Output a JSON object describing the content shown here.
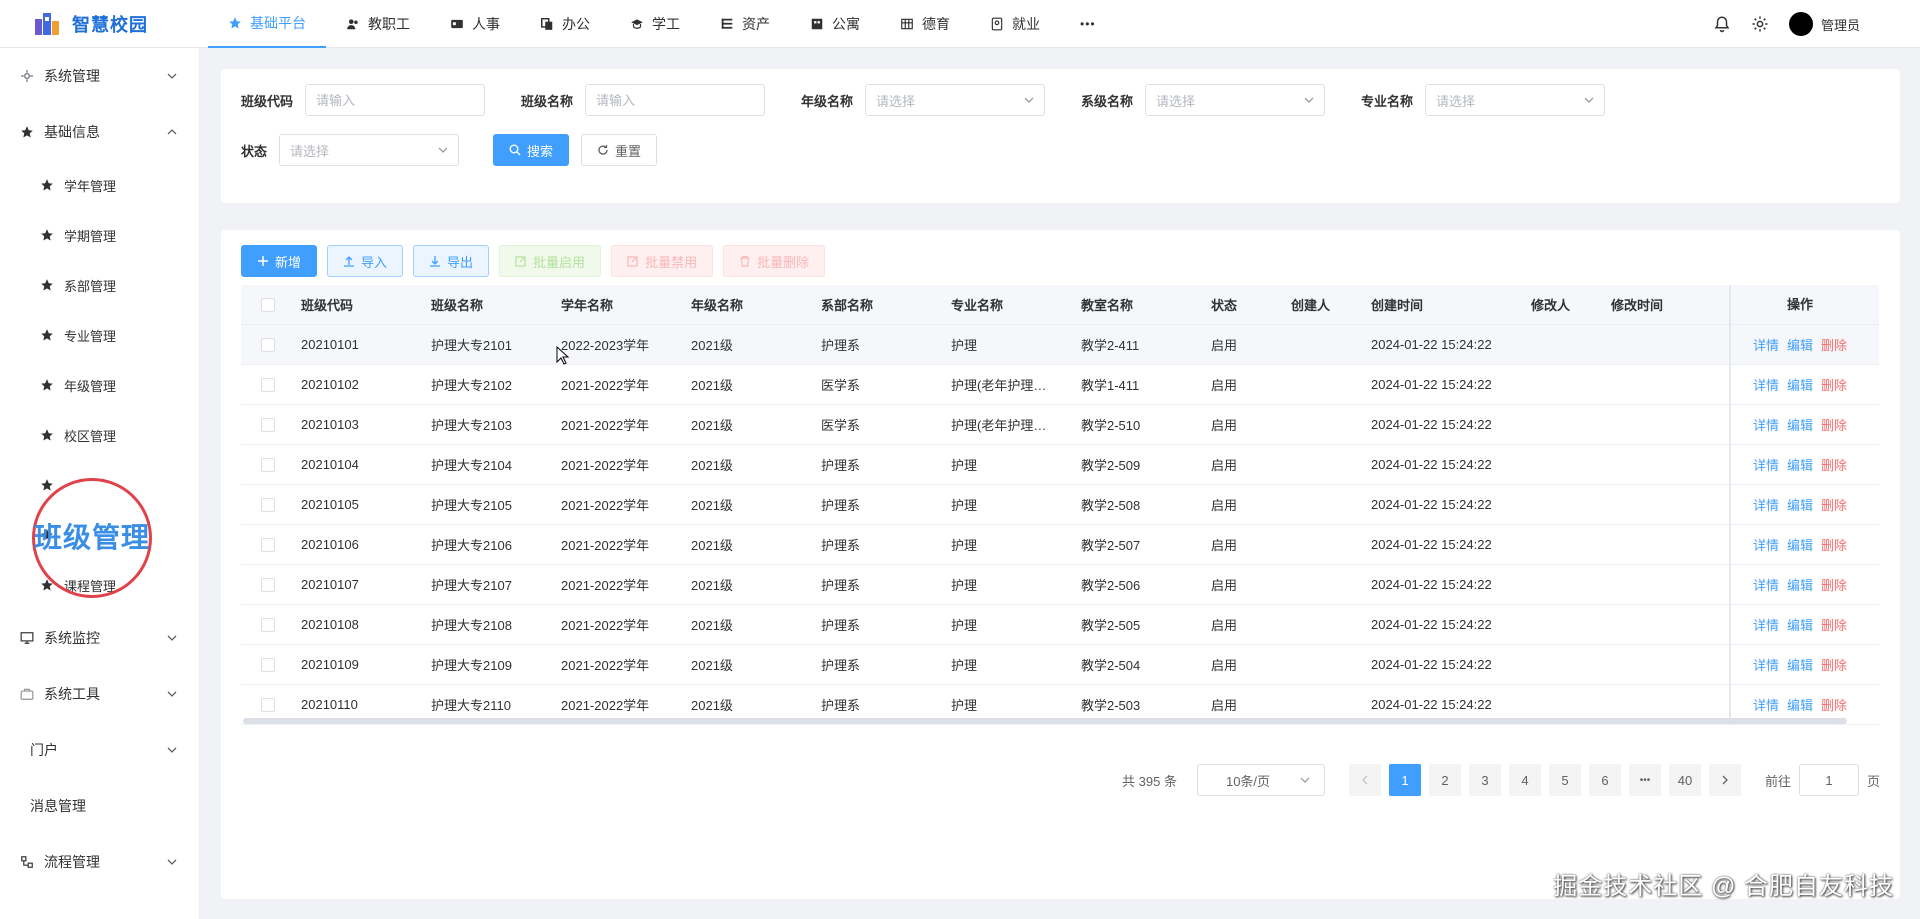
{
  "app": {
    "title": "智慧校园",
    "brand_color": "#1e6fd9",
    "accent_color": "#409eff"
  },
  "topnav": [
    {
      "label": "基础平台",
      "icon": "star-icon",
      "active": true
    },
    {
      "label": "教职工",
      "icon": "users-icon"
    },
    {
      "label": "人事",
      "icon": "id-card-icon"
    },
    {
      "label": "办公",
      "icon": "copy-icon"
    },
    {
      "label": "学工",
      "icon": "student-icon"
    },
    {
      "label": "资产",
      "icon": "list-icon"
    },
    {
      "label": "公寓",
      "icon": "building-icon"
    },
    {
      "label": "德育",
      "icon": "table-icon"
    },
    {
      "label": "就业",
      "icon": "badge-icon"
    },
    {
      "label": "•••",
      "icon": "more-icon"
    }
  ],
  "user": {
    "name": "管理员"
  },
  "sidebar": {
    "groups": {
      "system_manage": "系统管理",
      "basic_info": "基础信息",
      "system_monitor": "系统监控",
      "system_tools": "系统工具",
      "portal": "门户",
      "message": "消息管理",
      "workflow": "流程管理"
    },
    "basic_items": [
      "学年管理",
      "学期管理",
      "系部管理",
      "专业管理",
      "年级管理",
      "校区管理",
      "",
      "",
      "课程管理"
    ],
    "highlight_label": "班级管理"
  },
  "search": {
    "fields": {
      "class_code": {
        "label": "班级代码",
        "placeholder": "请输入"
      },
      "class_name": {
        "label": "班级名称",
        "placeholder": "请输入"
      },
      "grade_name": {
        "label": "年级名称",
        "placeholder": "请选择"
      },
      "dept_name": {
        "label": "系级名称",
        "placeholder": "请选择"
      },
      "major_name": {
        "label": "专业名称",
        "placeholder": "请选择"
      },
      "status": {
        "label": "状态",
        "placeholder": "请选择"
      }
    },
    "search_label": "搜索",
    "reset_label": "重置"
  },
  "toolbar": {
    "new_label": "新增",
    "import_label": "导入",
    "export_label": "导出",
    "batch_enable_label": "批量启用",
    "batch_disable_label": "批量禁用",
    "batch_delete_label": "批量删除"
  },
  "table": {
    "columns": [
      "班级代码",
      "班级名称",
      "学年名称",
      "年级名称",
      "系部名称",
      "专业名称",
      "教室名称",
      "状态",
      "创建人",
      "创建时间",
      "修改人",
      "修改时间",
      "操作"
    ],
    "actions": {
      "detail": "详情",
      "edit": "编辑",
      "delete": "删除"
    },
    "rows": [
      [
        "20210101",
        "护理大专2101",
        "2022-2023学年",
        "2021级",
        "护理系",
        "护理",
        "教学2-411",
        "启用",
        "",
        "2024-01-22 15:24:22",
        "",
        ""
      ],
      [
        "20210102",
        "护理大专2102",
        "2021-2022学年",
        "2021级",
        "医学系",
        "护理(老年护理…",
        "教学1-411",
        "启用",
        "",
        "2024-01-22 15:24:22",
        "",
        ""
      ],
      [
        "20210103",
        "护理大专2103",
        "2021-2022学年",
        "2021级",
        "医学系",
        "护理(老年护理…",
        "教学2-510",
        "启用",
        "",
        "2024-01-22 15:24:22",
        "",
        ""
      ],
      [
        "20210104",
        "护理大专2104",
        "2021-2022学年",
        "2021级",
        "护理系",
        "护理",
        "教学2-509",
        "启用",
        "",
        "2024-01-22 15:24:22",
        "",
        ""
      ],
      [
        "20210105",
        "护理大专2105",
        "2021-2022学年",
        "2021级",
        "护理系",
        "护理",
        "教学2-508",
        "启用",
        "",
        "2024-01-22 15:24:22",
        "",
        ""
      ],
      [
        "20210106",
        "护理大专2106",
        "2021-2022学年",
        "2021级",
        "护理系",
        "护理",
        "教学2-507",
        "启用",
        "",
        "2024-01-22 15:24:22",
        "",
        ""
      ],
      [
        "20210107",
        "护理大专2107",
        "2021-2022学年",
        "2021级",
        "护理系",
        "护理",
        "教学2-506",
        "启用",
        "",
        "2024-01-22 15:24:22",
        "",
        ""
      ],
      [
        "20210108",
        "护理大专2108",
        "2021-2022学年",
        "2021级",
        "护理系",
        "护理",
        "教学2-505",
        "启用",
        "",
        "2024-01-22 15:24:22",
        "",
        ""
      ],
      [
        "20210109",
        "护理大专2109",
        "2021-2022学年",
        "2021级",
        "护理系",
        "护理",
        "教学2-504",
        "启用",
        "",
        "2024-01-22 15:24:22",
        "",
        ""
      ],
      [
        "20210110",
        "护理大专2110",
        "2021-2022学年",
        "2021级",
        "护理系",
        "护理",
        "教学2-503",
        "启用",
        "",
        "2024-01-22 15:24:22",
        "",
        ""
      ]
    ]
  },
  "pagination": {
    "total_text": "共 395 条",
    "page_size": "10条/页",
    "pages": [
      "1",
      "2",
      "3",
      "4",
      "5",
      "6",
      "•••",
      "40"
    ],
    "current": "1",
    "goto_prefix": "前往",
    "goto_value": "1",
    "goto_suffix": "页"
  },
  "watermark": "掘金技术社区 @ 合肥自友科技"
}
